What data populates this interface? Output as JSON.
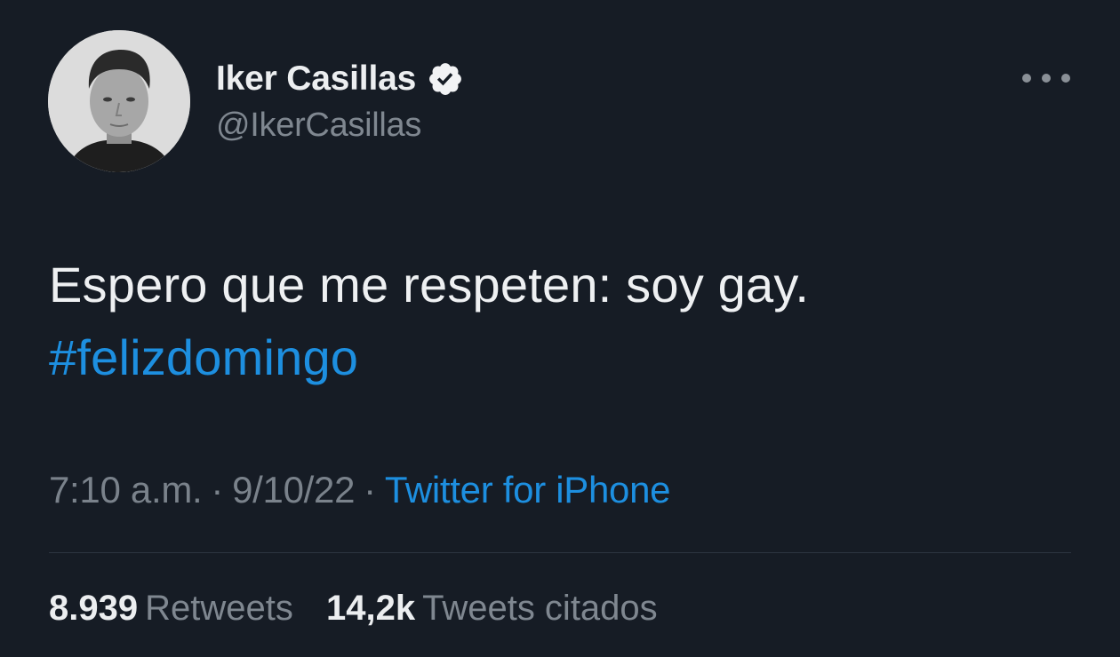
{
  "author": {
    "display_name": "Iker Casillas",
    "handle": "@IkerCasillas",
    "verified": true
  },
  "tweet": {
    "text": "Espero que me respeten: soy gay.",
    "hashtag": "#felizdomingo",
    "time": "7:10 a.m.",
    "separator": "·",
    "date": "9/10/22",
    "source": "Twitter for iPhone"
  },
  "stats": {
    "retweets_count": "8.939",
    "retweets_label": "Retweets",
    "quotes_count": "14,2k",
    "quotes_label": "Tweets citados"
  },
  "icons": {
    "verified": "verified-badge-icon",
    "more": "more-options-icon"
  },
  "colors": {
    "background": "#161c25",
    "link": "#1d8fe0",
    "secondary_text": "#7f8790"
  }
}
